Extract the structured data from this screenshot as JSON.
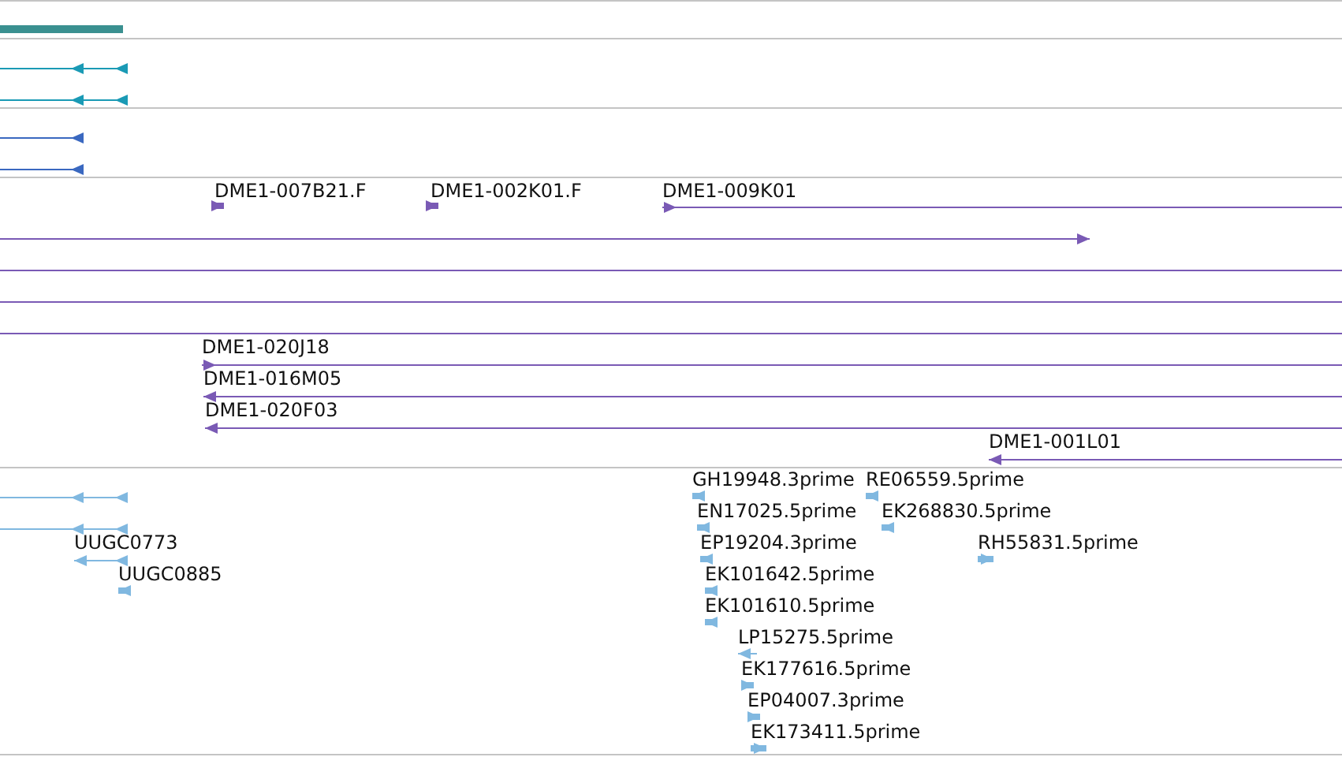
{
  "tracks": [
    {
      "color": "#3a9090",
      "features": [
        {
          "kind": "bar"
        }
      ]
    },
    {
      "color": "#1a9ab5",
      "features": [
        {
          "kind": "reverse"
        },
        {
          "kind": "reverse"
        }
      ]
    },
    {
      "color": "#3a68c0",
      "features": [
        {
          "kind": "reverse"
        },
        {
          "kind": "reverse"
        }
      ]
    },
    {
      "color": "#7a5ab5",
      "features": [
        {
          "kind": "forward",
          "label": "DME1-007B21.F"
        },
        {
          "kind": "forward",
          "label": "DME1-002K01.F"
        },
        {
          "kind": "forward",
          "label": "DME1-009K01"
        },
        {
          "kind": "forward"
        },
        {
          "kind": "plain"
        },
        {
          "kind": "plain"
        },
        {
          "kind": "plain"
        },
        {
          "kind": "forward",
          "label": "DME1-020J18"
        },
        {
          "kind": "reverse",
          "label": "DME1-016M05"
        },
        {
          "kind": "reverse",
          "label": "DME1-020F03"
        },
        {
          "kind": "reverse",
          "label": "DME1-001L01"
        }
      ]
    },
    {
      "color": "#80b8e0",
      "features": [
        {
          "kind": "reverse"
        },
        {
          "kind": "reverse"
        },
        {
          "kind": "reverse",
          "label": "UUGC0773"
        },
        {
          "kind": "reverse",
          "label": "UUGC0885"
        },
        {
          "kind": "reverse",
          "label": "GH19948.3prime"
        },
        {
          "kind": "reverse",
          "label": "RE06559.5prime"
        },
        {
          "kind": "reverse",
          "label": "EN17025.5prime"
        },
        {
          "kind": "reverse",
          "label": "EK268830.5prime"
        },
        {
          "kind": "reverse",
          "label": "EP19204.3prime"
        },
        {
          "kind": "forward",
          "label": "RH55831.5prime"
        },
        {
          "kind": "reverse",
          "label": "EK101642.5prime"
        },
        {
          "kind": "reverse",
          "label": "EK101610.5prime"
        },
        {
          "kind": "reverse",
          "label": "LP15275.5prime"
        },
        {
          "kind": "forward",
          "label": "EK177616.5prime"
        },
        {
          "kind": "forward",
          "label": "EP04007.3prime"
        },
        {
          "kind": "forward",
          "label": "EK173411.5prime"
        }
      ]
    }
  ]
}
